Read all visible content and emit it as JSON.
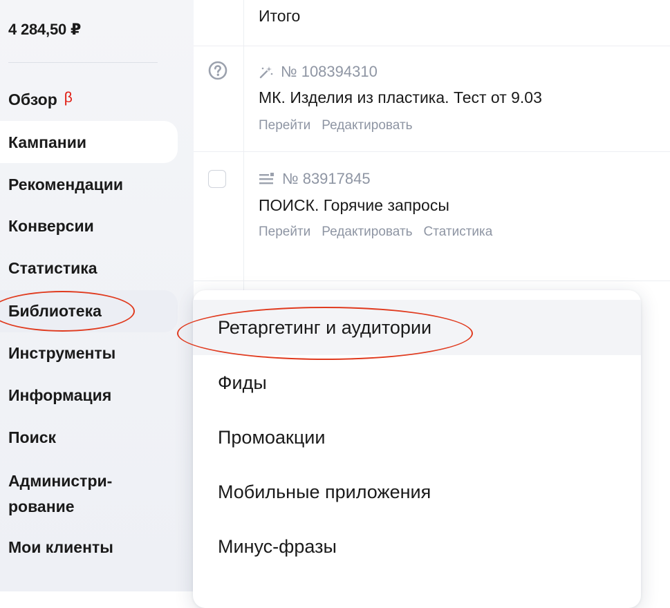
{
  "sidebar": {
    "balance": "4 284,50 ₽",
    "items": [
      {
        "label": "Обзор",
        "beta": "β"
      },
      {
        "label": "Кампании"
      },
      {
        "label": "Рекомендации"
      },
      {
        "label": "Конверсии"
      },
      {
        "label": "Статистика"
      },
      {
        "label": "Библиотека"
      },
      {
        "label": "Инструменты"
      },
      {
        "label": "Информация"
      },
      {
        "label": "Поиск"
      },
      {
        "label_line1": "Администри-",
        "label_line2": "рование"
      },
      {
        "label": "Мои клиенты"
      }
    ],
    "active_item": "Кампании",
    "hovered_item": "Библиотека"
  },
  "main": {
    "total_label": "Итого",
    "campaigns": [
      {
        "number": "№ 108394310",
        "type_icon": "magic-wand-icon",
        "status_icon": "question-circle-icon",
        "name": "МК. Изделия из пластика. Тест от 9.03",
        "actions": [
          "Перейти",
          "Редактировать"
        ]
      },
      {
        "number": "№ 83917845",
        "type_icon": "text-ad-icon",
        "status_icon": "checkbox",
        "name": "ПОИСК. Горячие запросы",
        "actions": [
          "Перейти",
          "Редактировать",
          "Статистика"
        ]
      }
    ]
  },
  "dropdown": {
    "items": [
      "Ретаргетинг и аудитории",
      "Фиды",
      "Промоакции",
      "Мобильные приложения",
      "Минус-фразы"
    ],
    "highlighted": "Ретаргетинг и аудитории"
  },
  "colors": {
    "beta": "#e0190f",
    "muted_text": "#8e95a3",
    "annotation": "#e03a1e",
    "sidebar_bg": "#f2f3f7"
  }
}
